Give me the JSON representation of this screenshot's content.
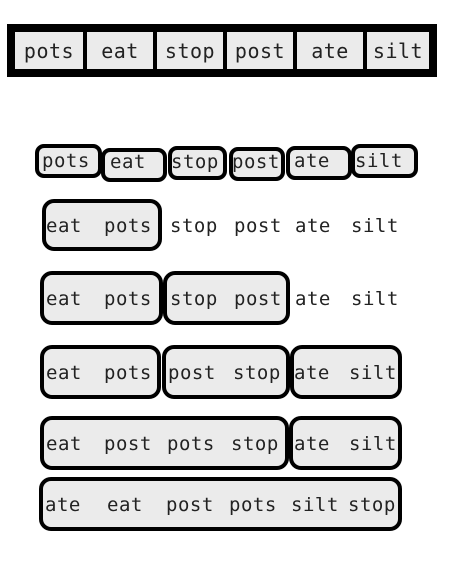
{
  "top_row": [
    "pots",
    "eat",
    "stop",
    "post",
    "ate",
    "silt"
  ],
  "rows": [
    {
      "words": [
        "pots",
        "eat",
        "stop",
        "post",
        "ate",
        "silt"
      ]
    },
    {
      "words": [
        "eat",
        "pots",
        "stop",
        "post",
        "ate",
        "silt"
      ]
    },
    {
      "words": [
        "eat",
        "pots",
        "stop",
        "post",
        "ate",
        "silt"
      ]
    },
    {
      "words": [
        "eat",
        "pots",
        "post",
        "stop",
        "ate",
        "silt"
      ]
    },
    {
      "words": [
        "eat",
        "post",
        "pots",
        "stop",
        "ate",
        "silt"
      ]
    },
    {
      "words": [
        "ate",
        "eat",
        "post",
        "pots",
        "silt",
        "stop"
      ]
    }
  ]
}
